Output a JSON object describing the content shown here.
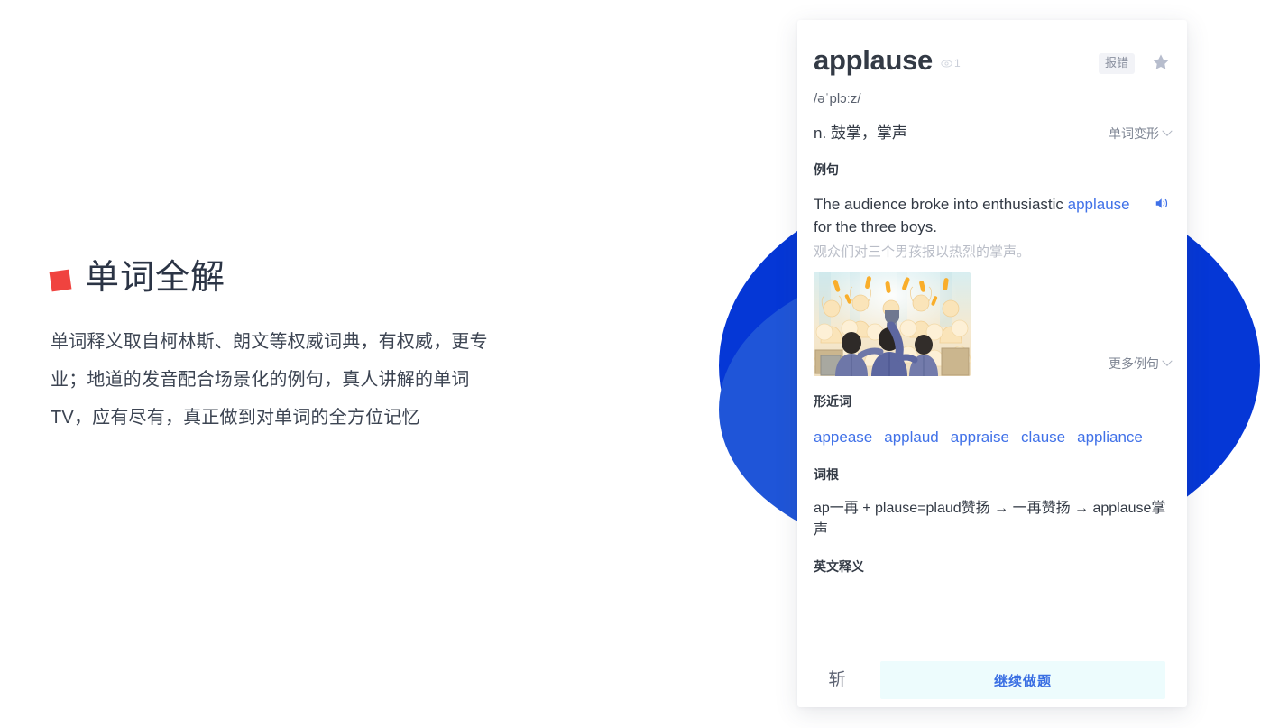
{
  "left_panel": {
    "bullet_color": "#F0433F",
    "heading": "单词全解",
    "body": "单词释义取自柯林斯、朗文等权威词典，有权威，更专业；地道的发音配合场景化的例句，真人讲解的单词TV，应有尽有，真正做到对单词的全方位记忆"
  },
  "decor": {
    "circle_back_color": "#0537D6",
    "circle_front_color": "#1F55D8"
  },
  "card": {
    "word": "applause",
    "view_count": "1",
    "report_label": "报错",
    "phonetic": "/əˈplɔːz/",
    "meaning": "n. 鼓掌，掌声",
    "inflection_label": "单词变形",
    "sections": {
      "example_title": "例句",
      "similar_title": "形近词",
      "root_title": "词根",
      "english_def_title": "英文释义"
    },
    "example": {
      "en_before": "The audience broke into enthusiastic ",
      "en_highlight": "applause",
      "en_after": " for the three boys.",
      "cn": "观众们对三个男孩报以热烈的掌声。",
      "more_label": "更多例句"
    },
    "similar_words": [
      "appease",
      "applaud",
      "appraise",
      "clause",
      "appliance"
    ],
    "root_text": "ap一再 + plause=plaud赞扬 → 一再赞扬 → applause掌声",
    "footer": {
      "left_label": "斩",
      "continue_label": "继续做题",
      "continue_bg": "#EDFCFD",
      "continue_color": "#3A6FE3"
    },
    "accent_blue": "#4071E8"
  }
}
